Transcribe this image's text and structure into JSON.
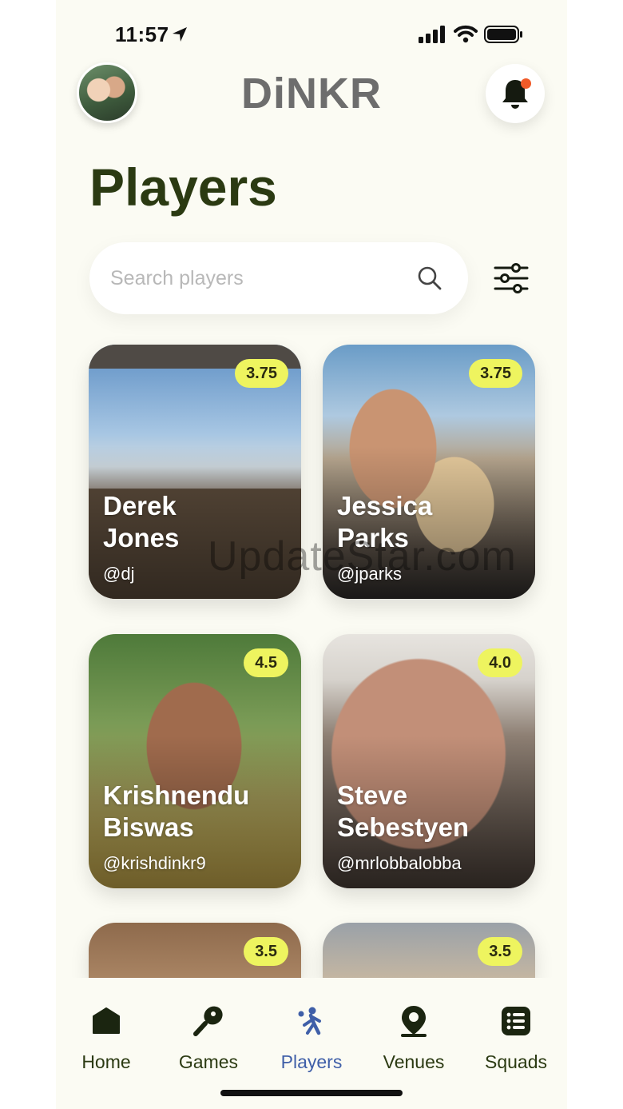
{
  "status_bar": {
    "time": "11:57"
  },
  "header": {
    "logo_text": "DiNKR"
  },
  "page": {
    "title": "Players"
  },
  "search": {
    "placeholder": "Search players"
  },
  "players": [
    {
      "first": "Derek",
      "last": "Jones",
      "handle": "@dj",
      "rating": "3.75"
    },
    {
      "first": "Jessica",
      "last": "Parks",
      "handle": "@jparks",
      "rating": "3.75"
    },
    {
      "first": "Krishnendu",
      "last": "Biswas",
      "handle": "@krishdinkr9",
      "rating": "4.5"
    },
    {
      "first": "Steve",
      "last": "Sebestyen",
      "handle": "@mrlobbalobba",
      "rating": "4.0"
    },
    {
      "rating": "3.5"
    },
    {
      "rating": "3.5"
    }
  ],
  "watermark": "UpdateStar.com",
  "tabs": [
    {
      "label": "Home",
      "icon": "home-icon"
    },
    {
      "label": "Games",
      "icon": "paddle-icon"
    },
    {
      "label": "Players",
      "icon": "player-icon",
      "active": true
    },
    {
      "label": "Venues",
      "icon": "location-pin-icon"
    },
    {
      "label": "Squads",
      "icon": "list-icon"
    }
  ],
  "colors": {
    "accent_yellow": "#eef45f",
    "title_green": "#2b3a12",
    "active_blue": "#3f5fa8",
    "notification_dot": "#f05a28",
    "background": "#fbfbf3"
  }
}
